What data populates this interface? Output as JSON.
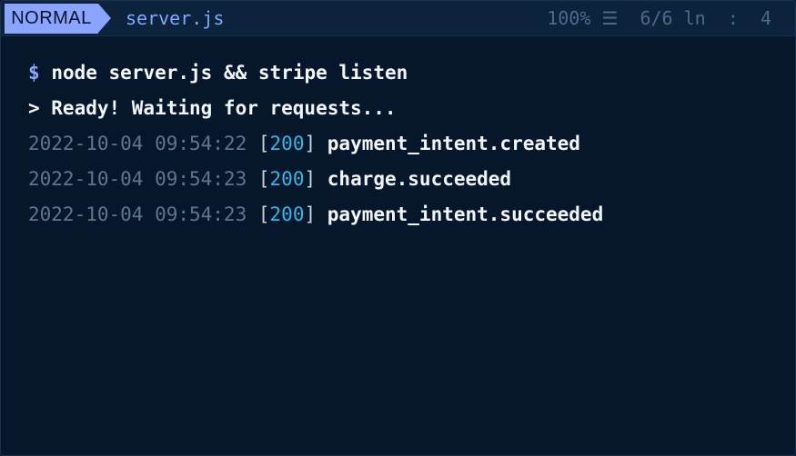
{
  "statusbar": {
    "mode": "NORMAL",
    "filename": "server.js",
    "percent": "100%",
    "menu_glyph": "☰",
    "lines": "6/6",
    "ln_label": "ln",
    "separator": ":",
    "column": "4"
  },
  "terminal": {
    "command": {
      "prompt": "$",
      "text": "node server.js && stripe listen"
    },
    "ready": "> Ready! Waiting for requests...",
    "events": [
      {
        "timestamp": "2022-10-04 09:54:22",
        "status": "200",
        "event": "payment_intent.created"
      },
      {
        "timestamp": "2022-10-04 09:54:23",
        "status": "200",
        "event": "charge.succeeded"
      },
      {
        "timestamp": "2022-10-04 09:54:23",
        "status": "200",
        "event": "payment_intent.succeeded"
      }
    ]
  },
  "colors": {
    "background": "#06172b",
    "mode_badge": "#8aa4ff",
    "filename": "#7ea9ff",
    "status_code": "#2fb8e8",
    "timestamp": "#5f7590"
  }
}
